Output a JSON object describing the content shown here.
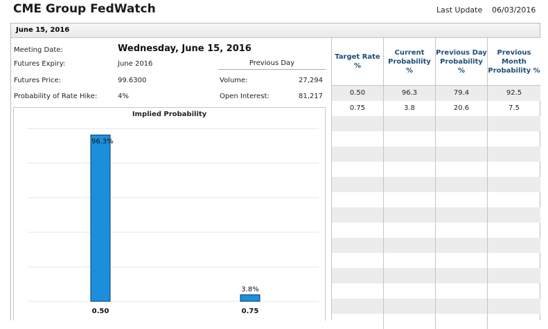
{
  "header": {
    "title": "CME Group FedWatch",
    "last_update_label": "Last Update",
    "last_update_value": "06/03/2016"
  },
  "panel": {
    "date_tab": "June 15, 2016"
  },
  "info": {
    "meeting_date_label": "Meeting Date:",
    "meeting_date_value": "Wednesday, June 15, 2016",
    "futures_expiry_label": "Futures Expiry:",
    "futures_expiry_value": "June 2016",
    "futures_price_label": "Futures Price:",
    "futures_price_value": "99.6300",
    "rate_hike_label": "Probability of Rate Hike:",
    "rate_hike_value": "4%",
    "previous_day_title": "Previous Day",
    "volume_label": "Volume:",
    "volume_value": "27,294",
    "open_interest_label": "Open Interest:",
    "open_interest_value": "81,217"
  },
  "table": {
    "headers": [
      "Target Rate %",
      "Current Probability %",
      "Previous Day Probability %",
      "Previous Month Probability %"
    ],
    "rows": [
      [
        "0.50",
        "96.3",
        "79.4",
        "92.5"
      ],
      [
        "0.75",
        "3.8",
        "20.6",
        "7.5"
      ]
    ]
  },
  "colors": {
    "bar_fill": "#1b8fdc",
    "bar_stroke": "#0d3a66",
    "header_text": "#1d4e7a"
  },
  "chart_data": {
    "type": "bar",
    "title": "Implied Probability",
    "categories": [
      "0.50",
      "0.75"
    ],
    "values": [
      96.3,
      3.8
    ],
    "data_labels": [
      "96.3%",
      "3.8%"
    ],
    "ylim": [
      0,
      100
    ],
    "grid": true
  }
}
